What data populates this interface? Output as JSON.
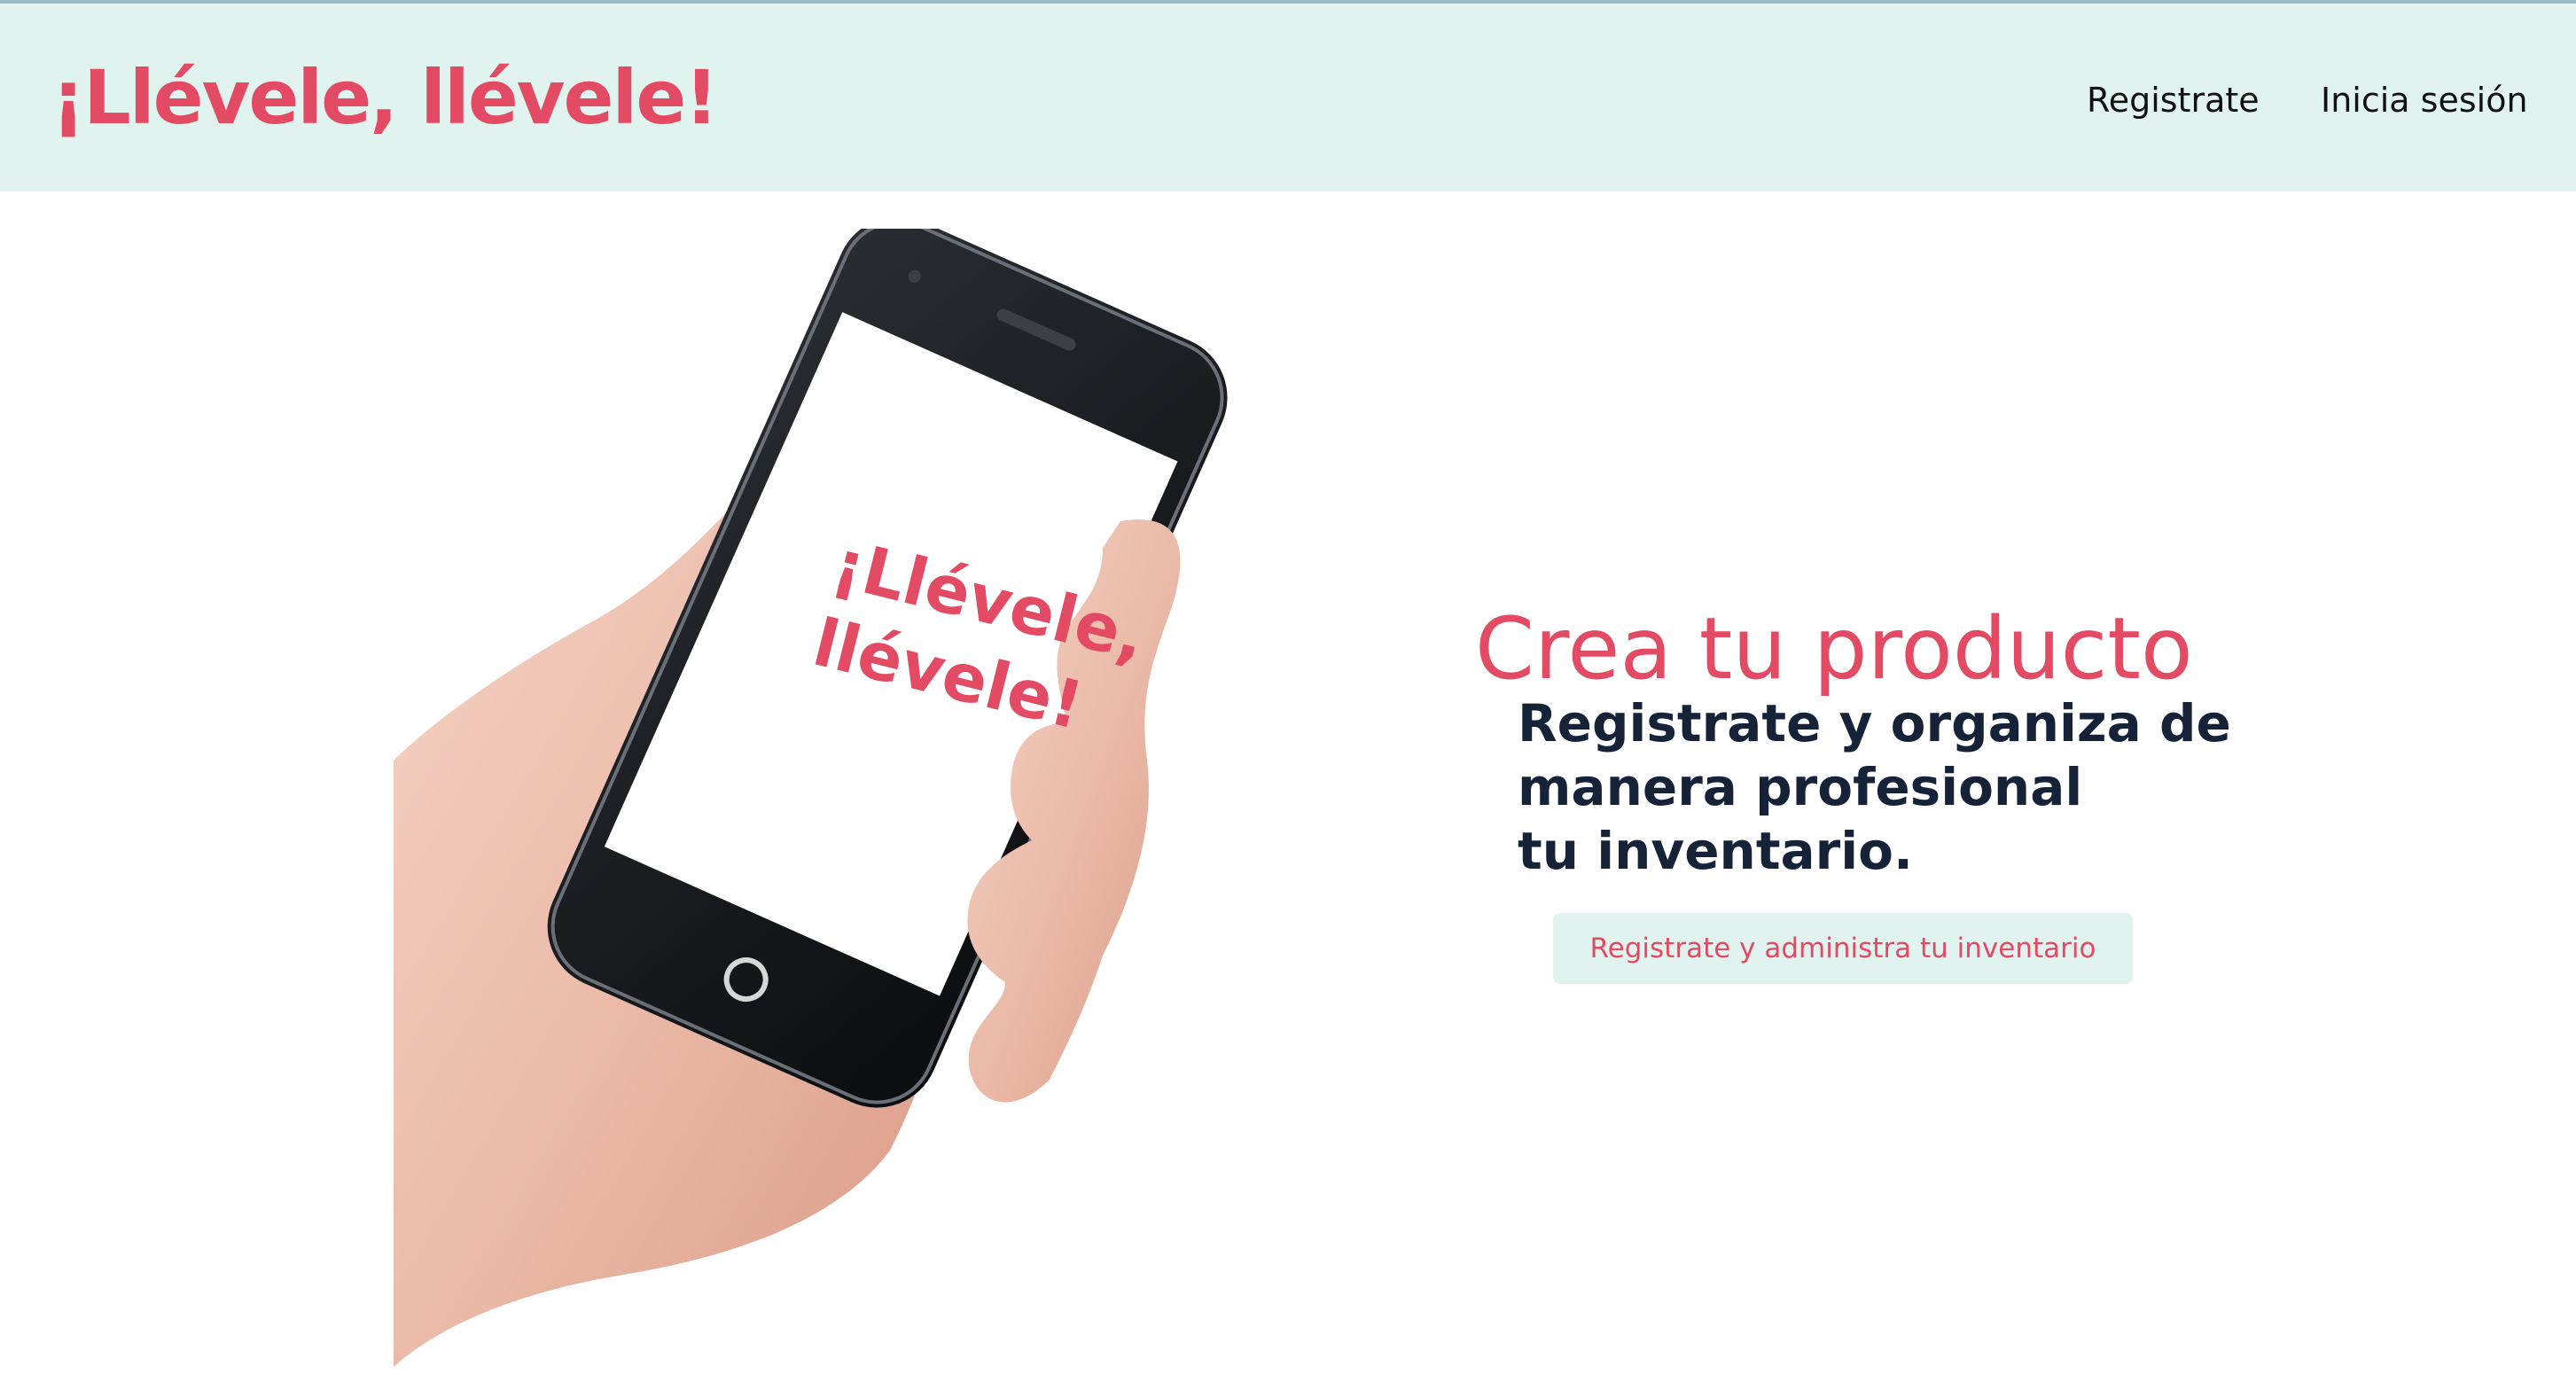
{
  "header": {
    "brand": "¡Llévele, llévele!",
    "nav": {
      "register": "Registrate",
      "login": "Inicia sesión"
    }
  },
  "hero": {
    "phone_screen_text": [
      "¡Llévele,",
      "llévele!"
    ],
    "title": "Crea tu producto",
    "subtitle_lines": [
      "Registrate y organiza de",
      "manera profesional",
      "tu inventario."
    ],
    "cta": "Registrate y administra tu inventario"
  },
  "colors": {
    "brand": "#e34a63",
    "nav_background": "#e1f3ef",
    "heading_dark": "#152238"
  }
}
